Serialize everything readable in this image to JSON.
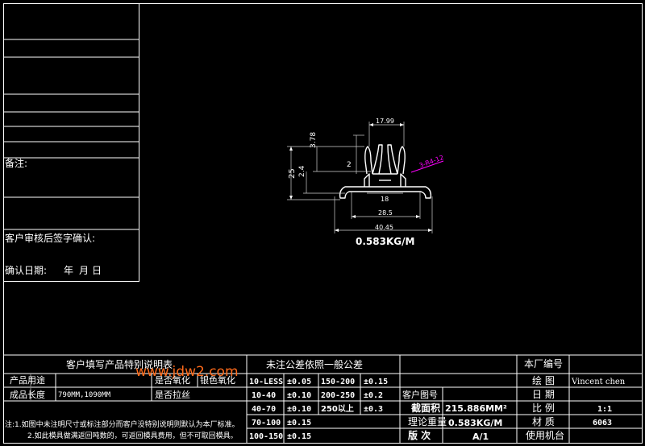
{
  "left_panel": {
    "remark_label": "备注:",
    "customer_confirm_label": "客户审核后签字确认:",
    "confirm_date_label": "确认日期:",
    "date_units": [
      "年",
      "月",
      "日"
    ]
  },
  "drawing": {
    "dims": {
      "top_width": "17.99",
      "height_3_78": "3.78",
      "height_2": "2",
      "height_25": "25",
      "height_2_4": "2.4",
      "inner_18": "18",
      "width_28_5": "28.5",
      "width_40_45": "40.45",
      "angle_label": "3-R4-12"
    },
    "weight_label": "0.583KG/M"
  },
  "title_block": {
    "customer_fill_title": "客户填写产品特别说明表",
    "watermark": "www.jdw2.com",
    "product_use_label": "产品用途",
    "product_length_label": "成品长度",
    "product_length_value": "790MM,1090MM",
    "oxidize_q": "是否氧化",
    "silver_oxidize_q": "银色氧化",
    "brushed_q": "是否拉丝",
    "tolerance_title": "未注公差依照一般公差",
    "tolerance_rows": [
      [
        "10-LESS",
        "±0.05",
        "150-200",
        "±0.15"
      ],
      [
        "10-40",
        "±0.10",
        "200-250",
        "±0.2"
      ],
      [
        "40-70",
        "±0.10",
        "250以上",
        "±0.3"
      ],
      [
        "70-100",
        "±0.15",
        "",
        ""
      ],
      [
        "100-150",
        "±0.15",
        "",
        ""
      ]
    ],
    "customer_drawing_no_label": "客户图号",
    "section_area_label": "截面积",
    "section_area_value": "215.886MM²",
    "theory_weight_label": "理论重量",
    "theory_weight_value": "0.583KG/M",
    "version_label": "版 次",
    "version_value": "A/1",
    "factory_no_label": "本厂编号",
    "drawn_label": "绘 图",
    "drawn_value": "Vincent chen",
    "date_label": "日 期",
    "scale_label": "比 例",
    "scale_value": "1:1",
    "material_label": "材 质",
    "material_value": "6063",
    "machine_label": "使用机台",
    "notes": [
      "注:1.如图中未注明尺寸或标注部分而客户没特别说明则默认为本厂标准。",
      "2.如此模具做满返回吨数的，可返回模具费用，但不可取回模具。"
    ]
  },
  "colors": {
    "line": "#ffffff",
    "dim_line": "#cfcfcf",
    "watermark": "#ff6a1a",
    "magenta": "#ff00ff"
  }
}
